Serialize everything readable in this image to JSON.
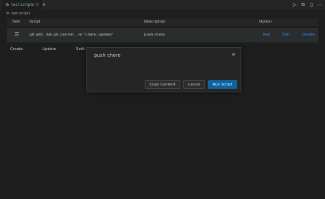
{
  "tab": {
    "icon": "settings-file-icon",
    "name": "test.scripts",
    "status": "U",
    "close": "×"
  },
  "toolbar": {
    "run_icon": "▷",
    "split_icon": "⧉",
    "layout_icon": "▯",
    "more_icon": "⋯"
  },
  "breadcrumb": {
    "icon": "settings-file-icon",
    "label": "test.scripts"
  },
  "table": {
    "headers": {
      "sort": "Sort",
      "script": "Script",
      "description": "Description",
      "option": "Option"
    },
    "rows": [
      {
        "drag": "☰",
        "script": "git add . && git commit . -m \"chore: update\"",
        "description": "push chore",
        "run": "Run",
        "edit": "Edit",
        "delete": "Delete"
      }
    ]
  },
  "actions": {
    "create": "Create",
    "update": "Update",
    "setting": "Setti"
  },
  "dialog": {
    "title": "push chore",
    "close": "×",
    "copy_label": "Copy Content",
    "cancel_label": "Cancel",
    "run_label": "Run Script"
  },
  "colors": {
    "accent": "#0e639c",
    "link": "#3794ff",
    "untracked": "#73c991"
  }
}
